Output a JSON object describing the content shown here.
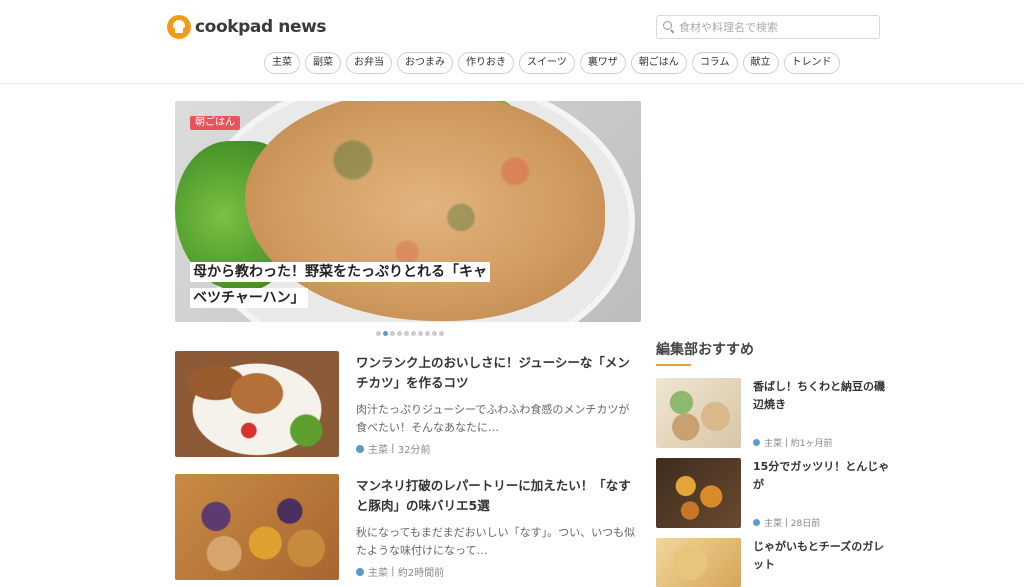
{
  "header": {
    "logo_text": "cookpad news",
    "search_placeholder": "食材や料理名で検索",
    "categories": [
      "主菜",
      "副菜",
      "お弁当",
      "おつまみ",
      "作りおき",
      "スイーツ",
      "裏ワザ",
      "朝ごはん",
      "コラム",
      "献立",
      "トレンド"
    ]
  },
  "hero": {
    "badge": "朝ごはん",
    "title": "母から教わった！野菜をたっぷりとれる「キャベツチャーハン」",
    "slide_count": 10,
    "active_slide": 2
  },
  "articles": [
    {
      "title": "ワンランク上のおいしさに！ジューシーな「メンチカツ」を作るコツ",
      "description": "肉汁たっぷりジューシーでふわふわ食感のメンチカツが食べたい！そんなあなたに…",
      "category": "主菜",
      "time": "32分前"
    },
    {
      "title": "マンネリ打破のレパートリーに加えたい！「なすと豚肉」の味バリエ5選",
      "description": "秋になってもまだまだおいしい「なす」。つい、いつも似たような味付けになって…",
      "category": "主菜",
      "time": "約2時間前"
    }
  ],
  "sidebar": {
    "heading": "編集部おすすめ",
    "items": [
      {
        "title": "香ばし！ちくわと納豆の磯辺焼き",
        "category": "主菜",
        "time": "約1ヶ月前"
      },
      {
        "title": "15分でガッツリ！とんじゃが",
        "category": "主菜",
        "time": "28日前"
      },
      {
        "title": "じゃがいもとチーズのガレット",
        "category": "",
        "time": ""
      }
    ]
  },
  "colors": {
    "accent": "#e8a23c",
    "badge": "#e8545c",
    "category_dot": "#5a9bc4"
  }
}
